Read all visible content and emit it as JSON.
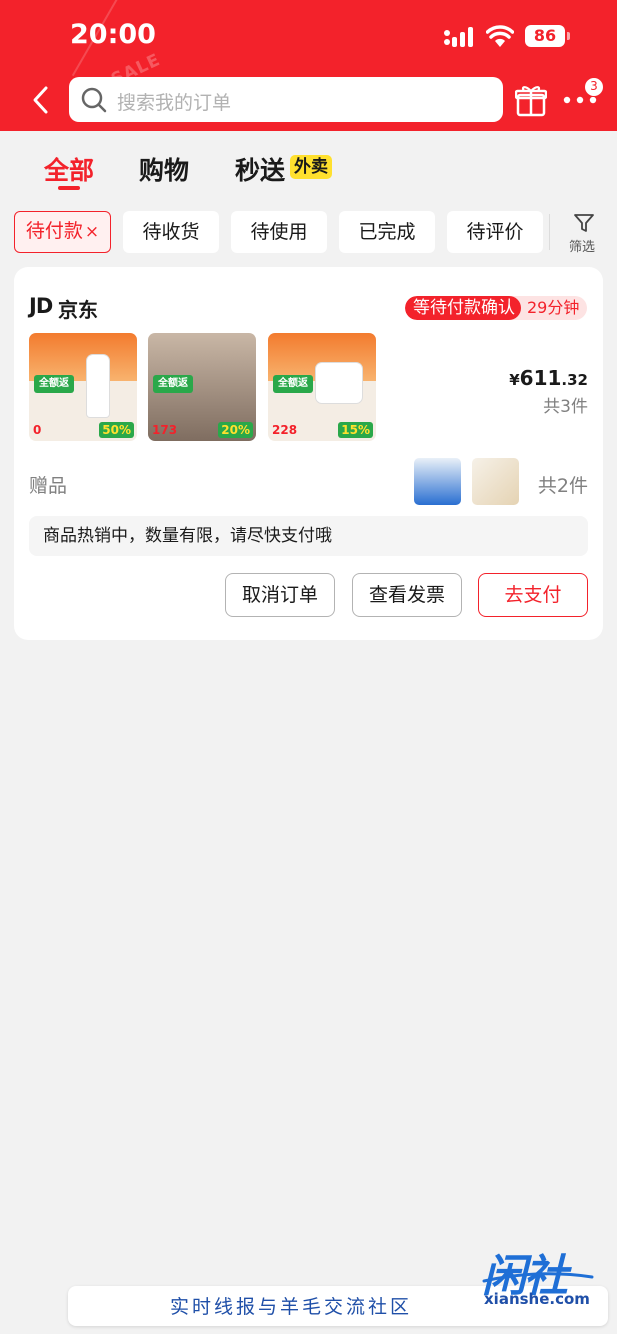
{
  "status_bar": {
    "time": "20:00",
    "battery": "86"
  },
  "header": {
    "search_placeholder": "搜索我的订单",
    "more_badge": "3"
  },
  "tabs": [
    {
      "label": "全部",
      "active": true
    },
    {
      "label": "购物",
      "active": false
    },
    {
      "label": "秒送",
      "active": false,
      "tag": "外卖"
    }
  ],
  "filters": {
    "chips": [
      {
        "label": "待付款",
        "active": true,
        "close": "×"
      },
      {
        "label": "待收货",
        "active": false
      },
      {
        "label": "待使用",
        "active": false
      },
      {
        "label": "已完成",
        "active": false
      },
      {
        "label": "待评价",
        "active": false
      }
    ],
    "filter_label": "筛选"
  },
  "order": {
    "logo_text": "JD",
    "shop_name": "京东",
    "status": "等待付款确认",
    "countdown": "29分钟",
    "products": [
      {
        "green_tag": "全额返",
        "price": "0",
        "pct": "50%"
      },
      {
        "green_tag": "全额返",
        "price": "173",
        "pct": "20%"
      },
      {
        "green_tag": "全额返",
        "price": "228",
        "pct": "15%"
      }
    ],
    "price_symbol": "¥",
    "price_main": "611",
    "price_decimal": ".32",
    "item_count": "共3件",
    "gift_label": "赠品",
    "gift_count": "共2件",
    "notice": "商品热销中，数量有限，请尽快支付哦",
    "buttons": {
      "cancel": "取消订单",
      "invoice": "查看发票",
      "pay": "去支付"
    }
  },
  "watermark": {
    "logo": "闲社",
    "url": "xianshe.com",
    "slogan": "实时线报与羊毛交流社区"
  },
  "colors": {
    "brand_red": "#f3222b",
    "waimai_yellow": "#ffe02e",
    "watermark_blue": "#1f4fa8"
  }
}
